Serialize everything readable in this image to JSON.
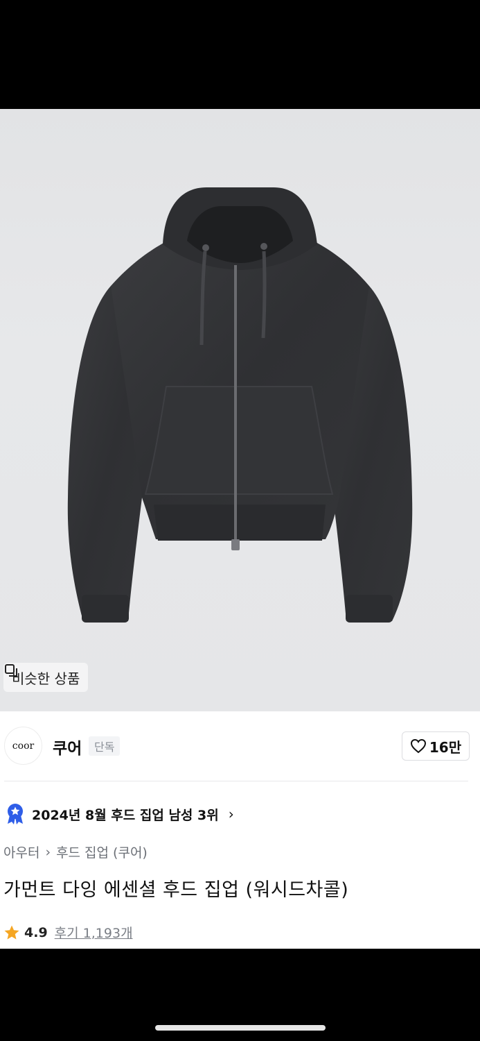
{
  "similar_button": {
    "label": "비슷한 상품",
    "icon": "copy-icon"
  },
  "brand": {
    "logo_text": "coor",
    "name": "쿠어",
    "tag": "단독"
  },
  "like": {
    "icon": "heart-outline-icon",
    "count": "16만"
  },
  "ranking": {
    "icon": "rank-medal-icon",
    "text": "2024년 8월 후드 집업 남성 3위",
    "chevron": "›"
  },
  "breadcrumb": {
    "category": "아우터",
    "separator": "›",
    "subcategory": "후드 집업 (쿠어)"
  },
  "product": {
    "title": "가먼트 다잉 에센셜 후드 집업 (워시드차콜)"
  },
  "rating": {
    "icon": "star-icon",
    "score": "4.9",
    "reviews": "후기 1,193개",
    "star_color": "#f5a623"
  },
  "colors": {
    "accent_blue": "#2f5ee8",
    "text": "#111111",
    "muted": "#6b6f76"
  }
}
